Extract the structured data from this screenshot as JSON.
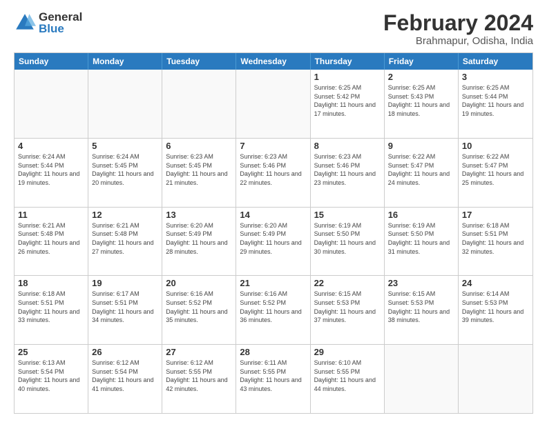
{
  "logo": {
    "general": "General",
    "blue": "Blue"
  },
  "header": {
    "month_year": "February 2024",
    "location": "Brahmapur, Odisha, India"
  },
  "weekdays": [
    "Sunday",
    "Monday",
    "Tuesday",
    "Wednesday",
    "Thursday",
    "Friday",
    "Saturday"
  ],
  "rows": [
    [
      {
        "day": "",
        "info": ""
      },
      {
        "day": "",
        "info": ""
      },
      {
        "day": "",
        "info": ""
      },
      {
        "day": "",
        "info": ""
      },
      {
        "day": "1",
        "info": "Sunrise: 6:25 AM\nSunset: 5:42 PM\nDaylight: 11 hours and 17 minutes."
      },
      {
        "day": "2",
        "info": "Sunrise: 6:25 AM\nSunset: 5:43 PM\nDaylight: 11 hours and 18 minutes."
      },
      {
        "day": "3",
        "info": "Sunrise: 6:25 AM\nSunset: 5:44 PM\nDaylight: 11 hours and 19 minutes."
      }
    ],
    [
      {
        "day": "4",
        "info": "Sunrise: 6:24 AM\nSunset: 5:44 PM\nDaylight: 11 hours and 19 minutes."
      },
      {
        "day": "5",
        "info": "Sunrise: 6:24 AM\nSunset: 5:45 PM\nDaylight: 11 hours and 20 minutes."
      },
      {
        "day": "6",
        "info": "Sunrise: 6:23 AM\nSunset: 5:45 PM\nDaylight: 11 hours and 21 minutes."
      },
      {
        "day": "7",
        "info": "Sunrise: 6:23 AM\nSunset: 5:46 PM\nDaylight: 11 hours and 22 minutes."
      },
      {
        "day": "8",
        "info": "Sunrise: 6:23 AM\nSunset: 5:46 PM\nDaylight: 11 hours and 23 minutes."
      },
      {
        "day": "9",
        "info": "Sunrise: 6:22 AM\nSunset: 5:47 PM\nDaylight: 11 hours and 24 minutes."
      },
      {
        "day": "10",
        "info": "Sunrise: 6:22 AM\nSunset: 5:47 PM\nDaylight: 11 hours and 25 minutes."
      }
    ],
    [
      {
        "day": "11",
        "info": "Sunrise: 6:21 AM\nSunset: 5:48 PM\nDaylight: 11 hours and 26 minutes."
      },
      {
        "day": "12",
        "info": "Sunrise: 6:21 AM\nSunset: 5:48 PM\nDaylight: 11 hours and 27 minutes."
      },
      {
        "day": "13",
        "info": "Sunrise: 6:20 AM\nSunset: 5:49 PM\nDaylight: 11 hours and 28 minutes."
      },
      {
        "day": "14",
        "info": "Sunrise: 6:20 AM\nSunset: 5:49 PM\nDaylight: 11 hours and 29 minutes."
      },
      {
        "day": "15",
        "info": "Sunrise: 6:19 AM\nSunset: 5:50 PM\nDaylight: 11 hours and 30 minutes."
      },
      {
        "day": "16",
        "info": "Sunrise: 6:19 AM\nSunset: 5:50 PM\nDaylight: 11 hours and 31 minutes."
      },
      {
        "day": "17",
        "info": "Sunrise: 6:18 AM\nSunset: 5:51 PM\nDaylight: 11 hours and 32 minutes."
      }
    ],
    [
      {
        "day": "18",
        "info": "Sunrise: 6:18 AM\nSunset: 5:51 PM\nDaylight: 11 hours and 33 minutes."
      },
      {
        "day": "19",
        "info": "Sunrise: 6:17 AM\nSunset: 5:51 PM\nDaylight: 11 hours and 34 minutes."
      },
      {
        "day": "20",
        "info": "Sunrise: 6:16 AM\nSunset: 5:52 PM\nDaylight: 11 hours and 35 minutes."
      },
      {
        "day": "21",
        "info": "Sunrise: 6:16 AM\nSunset: 5:52 PM\nDaylight: 11 hours and 36 minutes."
      },
      {
        "day": "22",
        "info": "Sunrise: 6:15 AM\nSunset: 5:53 PM\nDaylight: 11 hours and 37 minutes."
      },
      {
        "day": "23",
        "info": "Sunrise: 6:15 AM\nSunset: 5:53 PM\nDaylight: 11 hours and 38 minutes."
      },
      {
        "day": "24",
        "info": "Sunrise: 6:14 AM\nSunset: 5:53 PM\nDaylight: 11 hours and 39 minutes."
      }
    ],
    [
      {
        "day": "25",
        "info": "Sunrise: 6:13 AM\nSunset: 5:54 PM\nDaylight: 11 hours and 40 minutes."
      },
      {
        "day": "26",
        "info": "Sunrise: 6:12 AM\nSunset: 5:54 PM\nDaylight: 11 hours and 41 minutes."
      },
      {
        "day": "27",
        "info": "Sunrise: 6:12 AM\nSunset: 5:55 PM\nDaylight: 11 hours and 42 minutes."
      },
      {
        "day": "28",
        "info": "Sunrise: 6:11 AM\nSunset: 5:55 PM\nDaylight: 11 hours and 43 minutes."
      },
      {
        "day": "29",
        "info": "Sunrise: 6:10 AM\nSunset: 5:55 PM\nDaylight: 11 hours and 44 minutes."
      },
      {
        "day": "",
        "info": ""
      },
      {
        "day": "",
        "info": ""
      }
    ]
  ]
}
